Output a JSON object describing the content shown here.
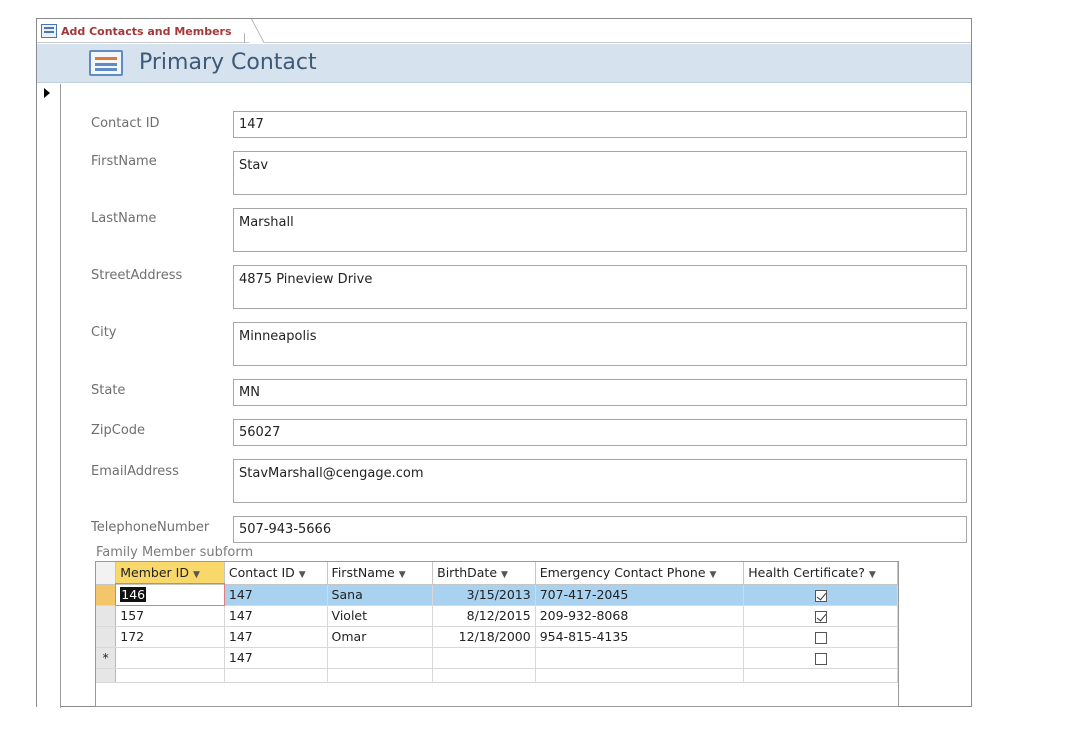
{
  "window": {
    "tab_title": "Add Contacts and Members",
    "form_title": "Primary Contact"
  },
  "fields": [
    {
      "label": "Contact ID",
      "value": "147"
    },
    {
      "label": "FirstName",
      "value": "Stav"
    },
    {
      "label": "LastName",
      "value": "Marshall"
    },
    {
      "label": "StreetAddress",
      "value": "4875 Pineview Drive"
    },
    {
      "label": "City",
      "value": "Minneapolis"
    },
    {
      "label": "State",
      "value": "MN"
    },
    {
      "label": "ZipCode",
      "value": "56027"
    },
    {
      "label": "EmailAddress",
      "value": "StavMarshall@cengage.com"
    },
    {
      "label": "TelephoneNumber",
      "value": "507-943-5666"
    }
  ],
  "subform": {
    "label": "Family Member subform",
    "columns": [
      "Member ID",
      "Contact ID",
      "FirstName",
      "BirthDate",
      "Emergency Contact Phone",
      "Health Certificate?"
    ],
    "rows": [
      {
        "member_id": "146",
        "contact_id": "147",
        "first_name": "Sana",
        "birth_date": "3/15/2013",
        "phone": "707-417-2045",
        "health_certificate": true
      },
      {
        "member_id": "157",
        "contact_id": "147",
        "first_name": "Violet",
        "birth_date": "8/12/2015",
        "phone": "209-932-8068",
        "health_certificate": true
      },
      {
        "member_id": "172",
        "contact_id": "147",
        "first_name": "Omar",
        "birth_date": "12/18/2000",
        "phone": "954-815-4135",
        "health_certificate": false
      }
    ],
    "new_row": {
      "marker": "*",
      "contact_id": "147",
      "health_certificate": false
    }
  }
}
